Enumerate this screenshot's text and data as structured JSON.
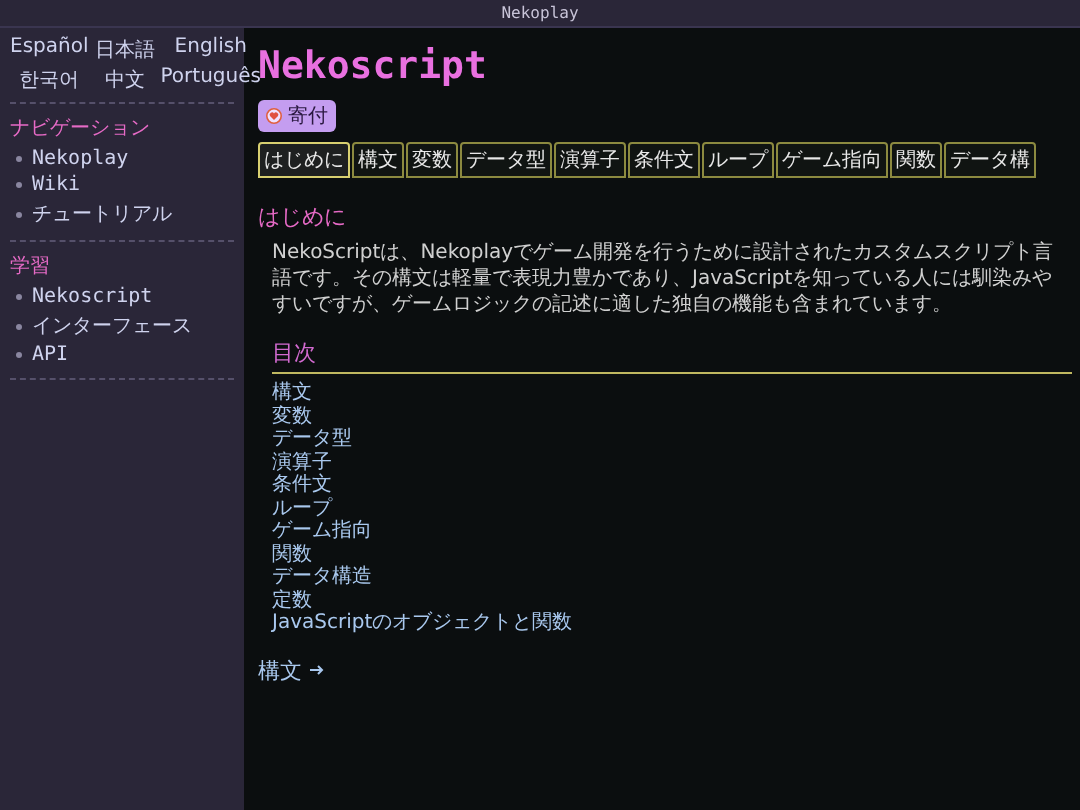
{
  "window": {
    "title": "Nekoplay"
  },
  "languages": [
    "Español",
    "日本語",
    "English",
    "한국어",
    "中文",
    "Português"
  ],
  "sidebar": {
    "sections": [
      {
        "heading": "ナビゲーション",
        "items": [
          "Nekoplay",
          "Wiki",
          "チュートリアル"
        ]
      },
      {
        "heading": "学習",
        "items": [
          "Nekoscript",
          "インターフェース",
          "API"
        ]
      }
    ]
  },
  "page": {
    "title": "Nekoscript",
    "donate_button": "寄付",
    "tabs": [
      {
        "label": "はじめに",
        "selected": true
      },
      {
        "label": "構文",
        "selected": false
      },
      {
        "label": "変数",
        "selected": false
      },
      {
        "label": "データ型",
        "selected": false
      },
      {
        "label": "演算子",
        "selected": false
      },
      {
        "label": "条件文",
        "selected": false
      },
      {
        "label": "ループ",
        "selected": false
      },
      {
        "label": "ゲーム指向",
        "selected": false
      },
      {
        "label": "関数",
        "selected": false
      },
      {
        "label": "データ構",
        "selected": false
      }
    ],
    "section_heading": "はじめに",
    "intro": "NekoScriptは、Nekoplayでゲーム開発を行うために設計されたカスタムスクリプト言語です。その構文は軽量で表現力豊かであり、JavaScriptを知っている人には馴染みやすいですが、ゲームロジックの記述に適した独自の機能も含まれています。",
    "toc": {
      "heading": "目次",
      "items": [
        "構文",
        "変数",
        "データ型",
        "演算子",
        "条件文",
        "ループ",
        "ゲーム指向",
        "関数",
        "データ構造",
        "定数",
        "JavaScriptのオブジェクトと関数"
      ]
    },
    "next_link": "構文"
  }
}
